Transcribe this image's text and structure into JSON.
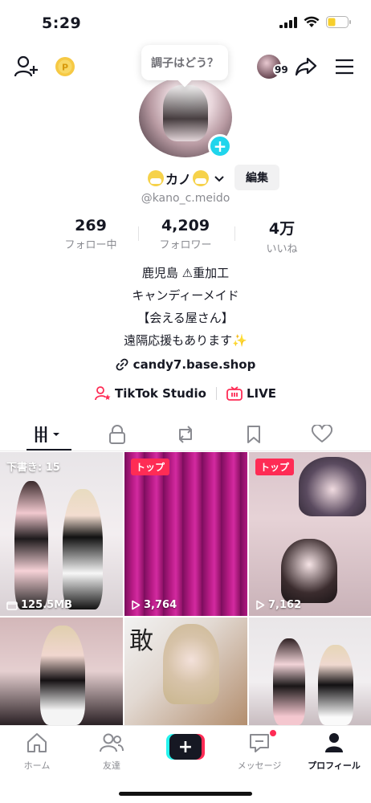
{
  "status_bar": {
    "time": "5:29"
  },
  "top_nav": {
    "mood_bubble": "調子はどう？",
    "friends_count": "99"
  },
  "profile": {
    "display_name": "カノ",
    "username": "@kano_c.meido",
    "edit_label": "編集"
  },
  "stats": [
    {
      "value": "269",
      "label": "フォロー中"
    },
    {
      "value": "4,209",
      "label": "フォロワー"
    },
    {
      "value": "4万",
      "label": "いいね"
    }
  ],
  "bio": {
    "lines": [
      "鹿児島 ⚠重加工",
      "キャンディーメイド",
      "【会える屋さん】",
      "遠隔応援もあります✨"
    ],
    "link": "candy7.base.shop"
  },
  "links_row": {
    "studio": "TikTok Studio",
    "live": "LIVE"
  },
  "tabs": [
    {
      "icon": "grid-icon"
    },
    {
      "icon": "lock-icon"
    },
    {
      "icon": "repost-icon"
    },
    {
      "icon": "bookmark-icon"
    },
    {
      "icon": "heart-icon"
    }
  ],
  "videos": [
    {
      "label": "下書き: 15",
      "meta": "125.5MB"
    },
    {
      "badge": "トップ",
      "views": "3,764"
    },
    {
      "badge": "トップ",
      "views": "7,162"
    },
    {},
    {
      "overlay_text": "敢"
    },
    {}
  ],
  "bottom_nav": [
    {
      "label": "ホーム",
      "icon": "home-icon"
    },
    {
      "label": "友達",
      "icon": "friends-icon"
    },
    {
      "label": "",
      "icon": "plus-icon"
    },
    {
      "label": "メッセージ",
      "icon": "message-icon"
    },
    {
      "label": "プロフィール",
      "icon": "profile-icon"
    }
  ],
  "colors": {
    "accent": "#fe2c55",
    "cyan": "#25f4ee",
    "text": "#161823",
    "muted": "#8a8b91",
    "avatar_plus": "#20d5ec"
  }
}
